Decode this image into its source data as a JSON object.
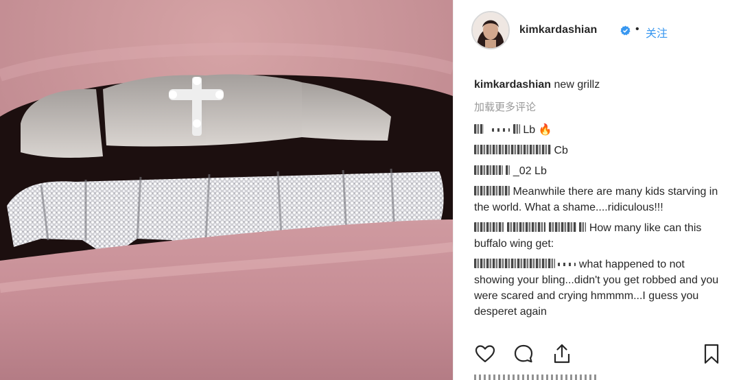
{
  "post": {
    "username": "kimkardashian",
    "follow_label": "关注",
    "dot_separator": "•"
  },
  "caption": {
    "username": "kimkardashian",
    "text": "new grillz"
  },
  "load_more_label": "加载更多评论",
  "comments": [
    {
      "text": "Lb 🔥"
    },
    {
      "text": "Cb"
    },
    {
      "text": "_02 Lb"
    },
    {
      "text": "Meanwhile there are many kids starving in the world. What a shame....ridiculous!!!"
    },
    {
      "text": "How many like can this buffalo wing get:"
    },
    {
      "text": "what happened to not showing your bling...didn't you get robbed and you were scared and crying hmmmm...I guess you desperet again"
    }
  ],
  "icons": {
    "verified": "verified-badge-icon",
    "like": "heart-icon",
    "comment": "speech-bubble-icon",
    "share": "share-icon",
    "save": "bookmark-icon"
  },
  "colors": {
    "follow_blue": "#3897f0",
    "verified_blue": "#3897f0",
    "muted_gray": "#999999",
    "text": "#262626"
  }
}
